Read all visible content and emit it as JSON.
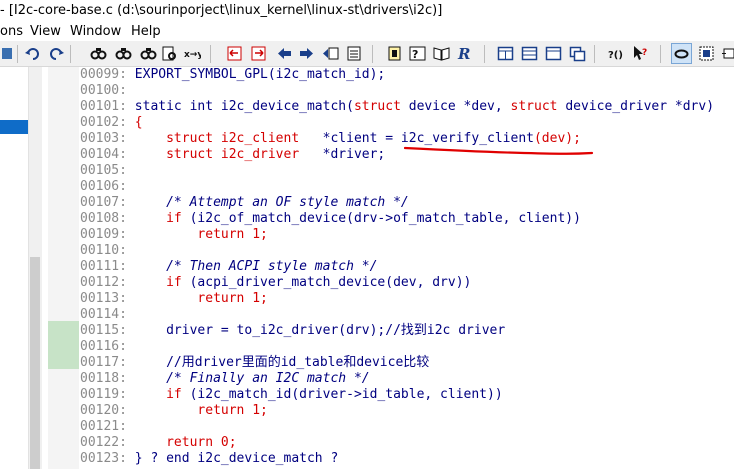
{
  "window": {
    "title": "- [I2c-core-base.c (d:\\sourinporject\\linux_kernel\\linux-st\\drivers\\i2c)]"
  },
  "menu": {
    "items": [
      "ons",
      "View",
      "Window",
      "Help"
    ]
  },
  "toolbar": {
    "icons": [
      "undo-icon",
      "redo-icon",
      "find-icon",
      "find-next-icon",
      "find-prev-icon",
      "find-in-files-icon",
      "replace-icon",
      "bookmark-prev-icon",
      "bookmark-next-icon",
      "back-arrow-icon",
      "forward-arrow-icon",
      "jump-icon",
      "symbol-window-icon",
      "project-icon",
      "info-icon",
      "book-icon",
      "relation-icon",
      "layout1-icon",
      "layout2-icon",
      "layout3-icon",
      "layout4-icon",
      "context-help-icon",
      "pointer-help-icon",
      "pressed-toggle-icon",
      "window-icon",
      "more-icon"
    ],
    "xy_label": "x→y",
    "help_label": "?()"
  },
  "code": {
    "lines": [
      {
        "num": "00099:",
        "segments": [
          {
            "t": "EXPORT_SYMBOL_GPL(i2c_match_id);",
            "c": "tx"
          }
        ]
      },
      {
        "num": "00100:",
        "segments": []
      },
      {
        "num": "00101:",
        "segments": [
          {
            "t": "static int ",
            "c": "kw"
          },
          {
            "t": "i2c_device_match",
            "c": "tx"
          },
          {
            "t": "(",
            "c": "tx"
          },
          {
            "t": "struct ",
            "c": "red"
          },
          {
            "t": "device ",
            "c": "tx"
          },
          {
            "t": "*dev, ",
            "c": "tx"
          },
          {
            "t": "struct ",
            "c": "red"
          },
          {
            "t": "device_driver ",
            "c": "tx"
          },
          {
            "t": "*drv)",
            "c": "tx"
          }
        ]
      },
      {
        "num": "00102:",
        "segments": [
          {
            "t": "{",
            "c": "red"
          }
        ]
      },
      {
        "num": "00103:",
        "segments": [
          {
            "t": "    struct i2c_client   ",
            "c": "red"
          },
          {
            "t": "*client = ",
            "c": "tx"
          },
          {
            "t": "i2c_verify_client",
            "c": "tx"
          },
          {
            "t": "(dev);",
            "c": "red"
          }
        ]
      },
      {
        "num": "00104:",
        "segments": [
          {
            "t": "    struct i2c_driver   ",
            "c": "red"
          },
          {
            "t": "*driver;",
            "c": "tx"
          }
        ]
      },
      {
        "num": "00105:",
        "segments": []
      },
      {
        "num": "00106:",
        "segments": []
      },
      {
        "num": "00107:",
        "segments": [
          {
            "t": "    /* Attempt an OF style match */",
            "c": "cm"
          }
        ]
      },
      {
        "num": "00108:",
        "segments": [
          {
            "t": "    if ",
            "c": "red"
          },
          {
            "t": "(i2c_of_match_device(drv->of_match_table, client))",
            "c": "tx"
          }
        ]
      },
      {
        "num": "00109:",
        "segments": [
          {
            "t": "        return 1;",
            "c": "red"
          }
        ]
      },
      {
        "num": "00110:",
        "segments": []
      },
      {
        "num": "00111:",
        "segments": [
          {
            "t": "    /* Then ACPI style match */",
            "c": "cm"
          }
        ]
      },
      {
        "num": "00112:",
        "segments": [
          {
            "t": "    if ",
            "c": "red"
          },
          {
            "t": "(acpi_driver_match_device(dev, drv))",
            "c": "tx"
          }
        ]
      },
      {
        "num": "00113:",
        "segments": [
          {
            "t": "        return 1;",
            "c": "red"
          }
        ]
      },
      {
        "num": "00114:",
        "segments": []
      },
      {
        "num": "00115:",
        "segments": [
          {
            "t": "    driver = to_i2c_driver(drv);//找到i2c driver",
            "c": "tx"
          }
        ]
      },
      {
        "num": "00116:",
        "segments": []
      },
      {
        "num": "00117:",
        "segments": [
          {
            "t": "    //用driver里面的id_table和device比较",
            "c": "tx"
          }
        ]
      },
      {
        "num": "00118:",
        "segments": [
          {
            "t": "    /* Finally an I2C match */",
            "c": "cm"
          }
        ]
      },
      {
        "num": "00119:",
        "segments": [
          {
            "t": "    if ",
            "c": "red"
          },
          {
            "t": "(i2c_match_id(driver->id_table, client))",
            "c": "tx"
          }
        ]
      },
      {
        "num": "00120:",
        "segments": [
          {
            "t": "        return 1;",
            "c": "red"
          }
        ]
      },
      {
        "num": "00121:",
        "segments": []
      },
      {
        "num": "00122:",
        "segments": [
          {
            "t": "    return 0;",
            "c": "red"
          }
        ]
      },
      {
        "num": "00123:",
        "segments": [
          {
            "t": "} ? end i2c_device_match ?",
            "c": "tx"
          }
        ]
      }
    ]
  },
  "colors": {
    "annotation_underline": "#e00000",
    "selected_item": "#0f6cc8",
    "gutter_highlight": "#c7e3c7"
  }
}
